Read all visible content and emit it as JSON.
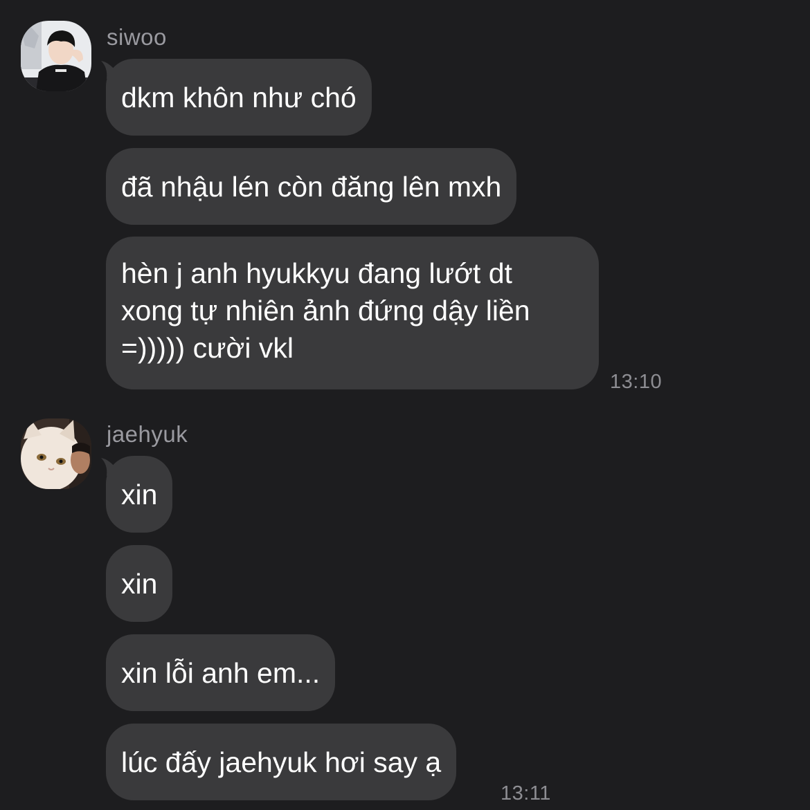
{
  "groups": [
    {
      "sender": "siwoo",
      "avatar_icon": "user-photo-siwoo",
      "messages": [
        "dkm khôn như chó",
        "đã nhậu lén còn đăng lên mxh"
      ],
      "last_message_lines": [
        "hèn j anh hyukkyu đang lướt dt",
        "xong tự nhiên ảnh đứng dậy liền",
        "=))))) cười vkl"
      ],
      "time": "13:10"
    },
    {
      "sender": "jaehyuk",
      "avatar_icon": "cat-photo-jaehyuk",
      "messages": [
        "xin",
        "xin",
        "xin lỗi anh em...",
        "lúc đấy jaehyuk hơi say ạ"
      ],
      "time": "13:11"
    }
  ],
  "colors": {
    "background": "#1d1d1f",
    "bubble": "#3a3a3c",
    "name": "#9a9aa0",
    "timestamp": "#8e8e93"
  }
}
